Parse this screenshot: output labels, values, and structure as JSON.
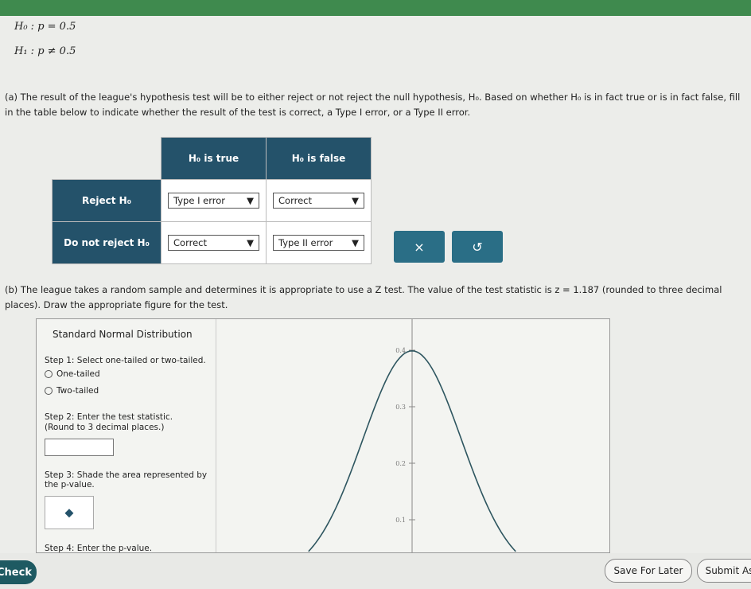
{
  "hypotheses": {
    "h0": "H₀ : p = 0.5",
    "h1": "H₁ : p ≠ 0.5"
  },
  "part_a": "(a) The result of the league's hypothesis test will be to either reject or not reject the null hypothesis, H₀. Based on whether H₀ is in fact true or is in fact false, fill in the table below to indicate whether the result of the test is correct, a Type I error, or a Type II error.",
  "table": {
    "col1": "H₀ is true",
    "col2": "H₀ is false",
    "rows": [
      {
        "label": "Reject H₀",
        "v1": "Type I error",
        "v2": "Correct"
      },
      {
        "label": "Do not reject H₀",
        "v1": "Correct",
        "v2": "Type II error"
      }
    ]
  },
  "buttons": {
    "clear": "×",
    "undo": "↺",
    "check": "Check",
    "save": "Save For Later",
    "submit": "Submit As"
  },
  "part_b": "(b) The league takes a random sample and determines it is appropriate to use a Z test. The value of the test statistic is z = 1.187 (rounded to three decimal places). Draw the appropriate figure for the test.",
  "panel": {
    "title": "Standard Normal Distribution",
    "step1": "Step 1: Select one-tailed or two-tailed.",
    "opt1": "One-tailed",
    "opt2": "Two-tailed",
    "step2": "Step 2: Enter the test statistic.",
    "step2b": "(Round to 3 decimal places.)",
    "step3": "Step 3: Shade the area represented by",
    "step3b": "the p-value.",
    "step4": "Step 4: Enter the p-value."
  },
  "chart_data": {
    "type": "line",
    "title": "",
    "curve": "standard normal pdf",
    "yticks": [
      "0.1",
      "0.2",
      "0.3",
      "0.4"
    ],
    "ylim": [
      0.04,
      0.42
    ],
    "xlim": [
      -4,
      4
    ]
  },
  "colors": {
    "header": "#24526a",
    "accent": "#2a6e86",
    "curve": "#2e5660"
  }
}
